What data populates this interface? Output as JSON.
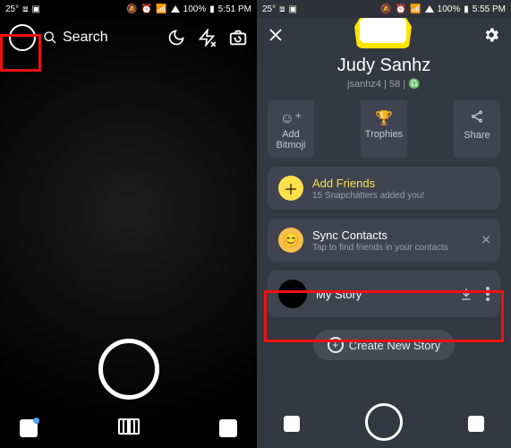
{
  "left": {
    "status": {
      "temp": "25°",
      "battery": "100%",
      "time": "5:51 PM"
    },
    "search_label": "Search"
  },
  "right": {
    "status": {
      "temp": "25°",
      "battery": "100%",
      "time": "5:55 PM"
    },
    "display_name": "Judy Sanhz",
    "meta": "jsanhz4 | 58 | ♎",
    "trio": {
      "bitmoji": "Add Bitmoji",
      "trophies": "Trophies",
      "share": "Share"
    },
    "add_friends": {
      "title": "Add Friends",
      "sub": "15 Snapchatters added you!"
    },
    "sync": {
      "title": "Sync Contacts",
      "sub": "Tap to find friends in your contacts"
    },
    "my_story": {
      "title": "My Story"
    },
    "create_story": "Create New Story"
  }
}
